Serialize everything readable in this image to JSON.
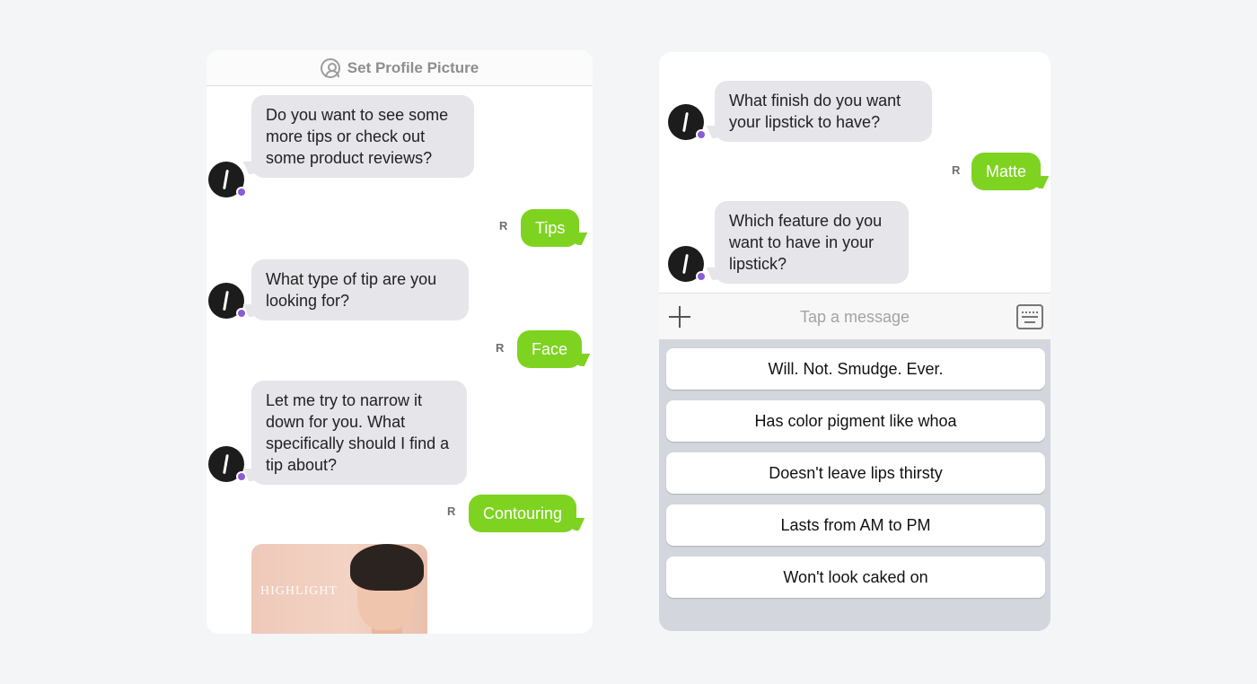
{
  "left_panel": {
    "header": {
      "title": "Set Profile Picture"
    },
    "messages": [
      {
        "from": "bot",
        "text": "Do you want to see some more tips or check out some product reviews?"
      },
      {
        "from": "user",
        "text": "Tips",
        "status": "R"
      },
      {
        "from": "bot",
        "text": "What type of tip are you looking for?"
      },
      {
        "from": "user",
        "text": "Face",
        "status": "R"
      },
      {
        "from": "bot",
        "text": "Let me try to narrow it down for you. What specifically should I find a tip about?"
      },
      {
        "from": "user",
        "text": "Contouring",
        "status": "R"
      }
    ],
    "media": {
      "overlay_text": "HIGHLIGHT"
    }
  },
  "right_panel": {
    "messages": [
      {
        "from": "bot",
        "text": "What finish do you want your lipstick to have?"
      },
      {
        "from": "user",
        "text": "Matte",
        "status": "R"
      },
      {
        "from": "bot",
        "text": "Which feature do you want to have in your lipstick?"
      }
    ],
    "composer": {
      "placeholder": "Tap a message"
    },
    "quick_replies": [
      "Will. Not. Smudge. Ever.",
      "Has color pigment like whoa",
      "Doesn't leave lips thirsty",
      "Lasts from AM to PM",
      "Won't look caked on"
    ]
  },
  "colors": {
    "user_bubble": "#7ed321",
    "bot_bubble": "#e5e5ea",
    "badge": "#8a5cd6"
  },
  "icons": [
    "profile-icon",
    "read-receipt-icon",
    "bot-avatar",
    "plus-icon",
    "keyboard-icon"
  ]
}
